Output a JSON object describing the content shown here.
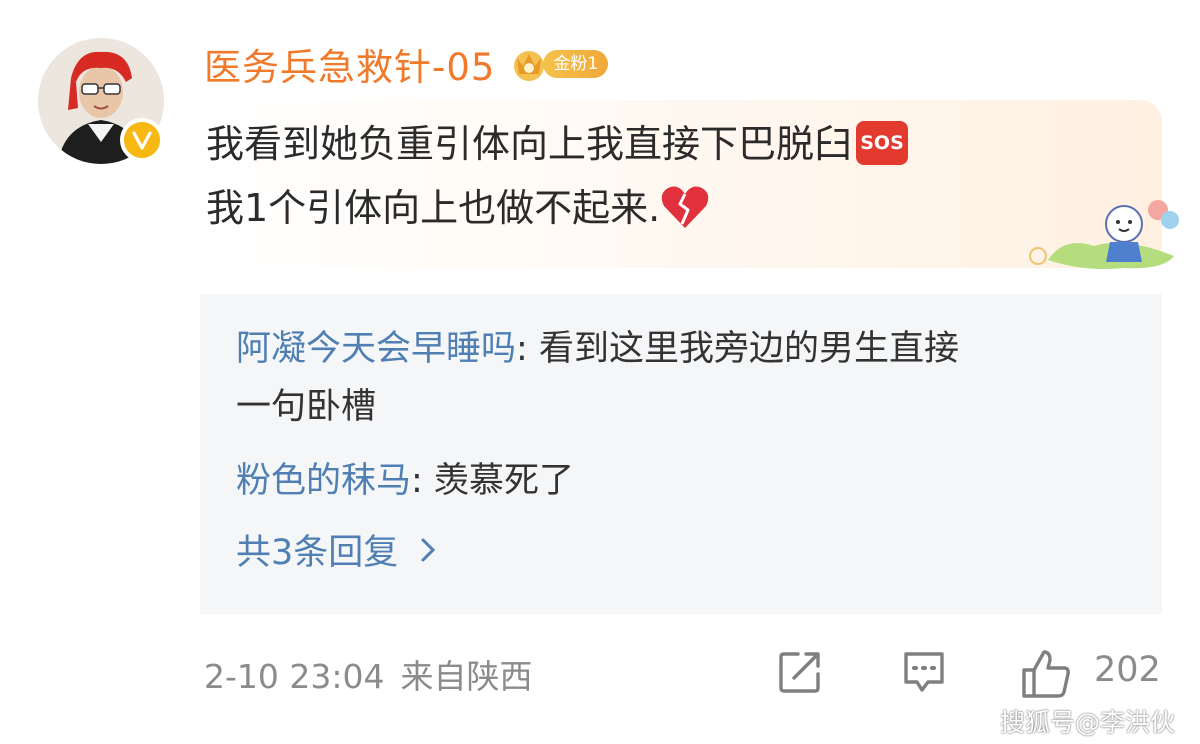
{
  "comment": {
    "username": "医务兵急救针-05",
    "fan_badge": "金粉1",
    "line1": "我看到她负重引体向上我直接下巴脱臼",
    "sos_emoji": "SOS",
    "line2": "我1个引体向上也做不起来.",
    "heart_emoji": "broken-heart-icon",
    "time": "2-10 23:04",
    "location": "来自陕西",
    "like_count": "202"
  },
  "replies": [
    {
      "user": "阿凝今天会早睡吗",
      "sep": ":",
      "text": " 看到这里我旁边的男生直接",
      "text2": "一句卧槽"
    },
    {
      "user": "粉色的秣马",
      "sep": ":",
      "text": " 羡慕死了"
    }
  ],
  "more_replies": "共3条回复",
  "watermark": "搜狐号@李洪伙",
  "colors": {
    "username": "#f0792a",
    "reply_user": "#4f7fb3",
    "badge": "#f6b811",
    "reply_bg": "#f5f6f8"
  }
}
